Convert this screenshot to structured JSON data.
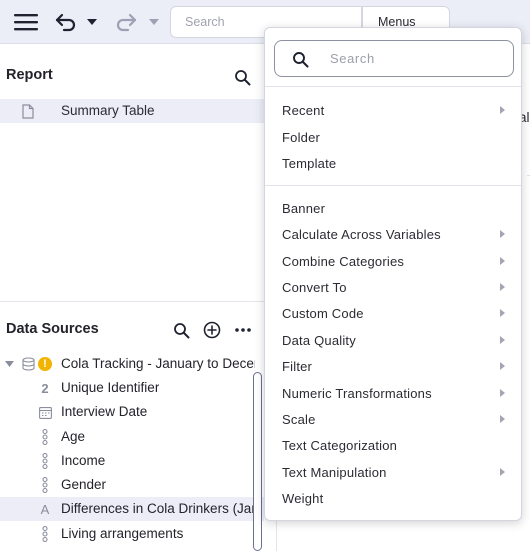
{
  "toolbar": {
    "search_placeholder": "Search",
    "menus_label": "Menus"
  },
  "report": {
    "title": "Report",
    "items": [
      {
        "label": "Summary Table"
      }
    ]
  },
  "data_sources": {
    "title": "Data Sources",
    "dataset": {
      "label": "Cola Tracking - January to Decem",
      "warning": "!"
    },
    "variables": [
      {
        "label": "Unique Identifier",
        "icon": "2"
      },
      {
        "label": "Interview Date",
        "icon": "calendar-icon"
      },
      {
        "label": "Age",
        "icon": "ordinal-icon"
      },
      {
        "label": "Income",
        "icon": "ordinal-icon"
      },
      {
        "label": "Gender",
        "icon": "ordinal-icon"
      },
      {
        "label": "Differences in Cola Drinkers (Jan",
        "icon": "A"
      },
      {
        "label": "Living arrangements",
        "icon": "ordinal-icon"
      }
    ]
  },
  "background_fragment": "al",
  "menu": {
    "search_placeholder": "Search",
    "group1": [
      {
        "label": "Recent",
        "has_submenu": true
      },
      {
        "label": "Folder",
        "has_submenu": false
      },
      {
        "label": "Template",
        "has_submenu": false
      }
    ],
    "group2": [
      {
        "label": "Banner",
        "has_submenu": false
      },
      {
        "label": "Calculate Across Variables",
        "has_submenu": true
      },
      {
        "label": "Combine Categories",
        "has_submenu": true
      },
      {
        "label": "Convert To",
        "has_submenu": true
      },
      {
        "label": "Custom Code",
        "has_submenu": true
      },
      {
        "label": "Data Quality",
        "has_submenu": true
      },
      {
        "label": "Filter",
        "has_submenu": true
      },
      {
        "label": "Numeric Transformations",
        "has_submenu": true
      },
      {
        "label": "Scale",
        "has_submenu": true
      },
      {
        "label": "Text Categorization",
        "has_submenu": false
      },
      {
        "label": "Text Manipulation",
        "has_submenu": true
      },
      {
        "label": "Weight",
        "has_submenu": false
      }
    ]
  }
}
